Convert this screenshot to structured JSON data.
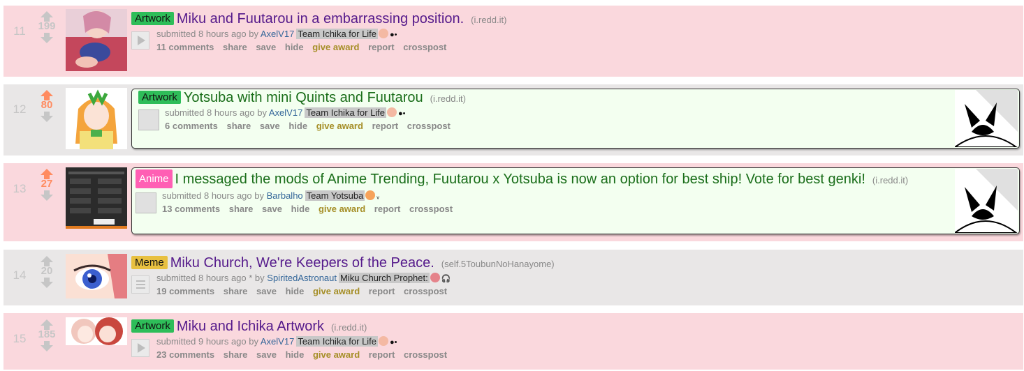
{
  "colors": {
    "pink_row": "#fad8dd",
    "grey_row": "#e9e7e7",
    "upvote": "#ff8b60",
    "artwork_flair": "#2ebd59",
    "anime_flair": "#ff5fb4",
    "meme_flair": "#e8c040"
  },
  "actions": {
    "share": "share",
    "save": "save",
    "hide": "hide",
    "give_award": "give award",
    "report": "report",
    "crosspost": "crosspost"
  },
  "posts": [
    {
      "rank": "11",
      "score": "199",
      "flair": "Artwork",
      "title": "Miku and Fuutarou in a embarrassing position.",
      "domain": "(i.redd.it)",
      "submitted": "submitted 8 hours ago by",
      "author": "AxelV17",
      "user_flair": "Team Ichika for Life",
      "comments": "11 comments"
    },
    {
      "rank": "12",
      "score": "80",
      "flair": "Artwork",
      "title": "Yotsuba with mini Quints and Fuutarou",
      "domain": "(i.redd.it)",
      "submitted": "submitted 8 hours ago by",
      "author": "AxelV17",
      "user_flair": "Team Ichika for Life",
      "comments": "6 comments"
    },
    {
      "rank": "13",
      "score": "27",
      "flair": "Anime",
      "title": "I messaged the mods of Anime Trending, Fuutarou x Yotsuba is now an option for best ship! Vote for best genki!",
      "domain": "(i.redd.it)",
      "submitted": "submitted 8 hours ago by",
      "author": "Barbalho",
      "user_flair": "Team Yotsuba",
      "comments": "13 comments"
    },
    {
      "rank": "14",
      "score": "20",
      "flair": "Meme",
      "title": "Miku Church, We're Keepers of the Peace.",
      "domain": "(self.5ToubunNoHanayome)",
      "submitted": "submitted 8 hours ago * by",
      "author": "SpiritedAstronaut",
      "user_flair": "Miku Church Prophet:",
      "comments": "19 comments"
    },
    {
      "rank": "15",
      "score": "185",
      "flair": "Artwork",
      "title": "Miku and Ichika Artwork",
      "domain": "(i.redd.it)",
      "submitted": "submitted 9 hours ago by",
      "author": "AxelV17",
      "user_flair": "Team Ichika for Life",
      "comments": "23 comments"
    }
  ]
}
